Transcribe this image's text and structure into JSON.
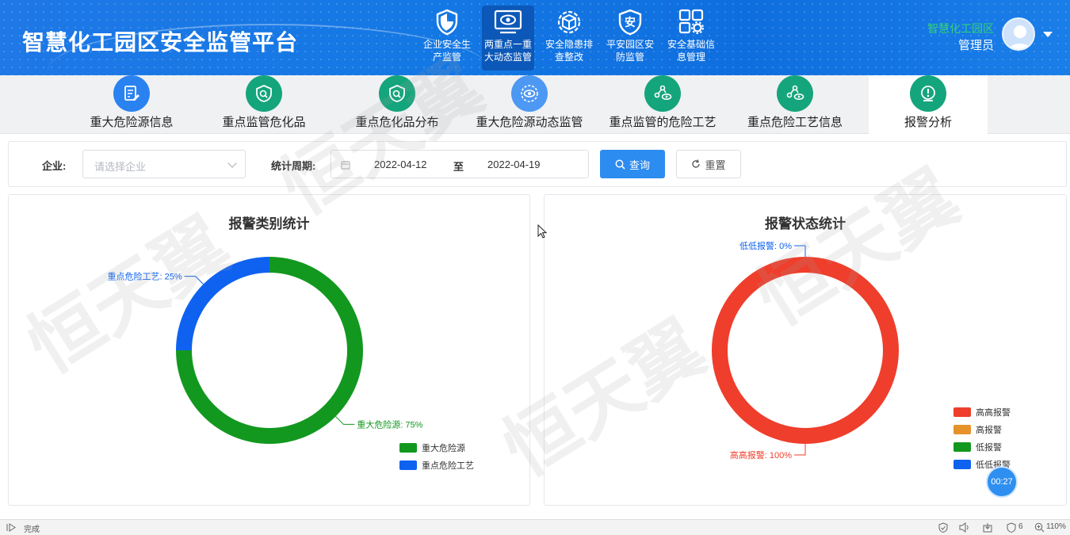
{
  "app": {
    "title": "智慧化工园区安全监管平台"
  },
  "top_nav": [
    {
      "label": "企业安全生产监管",
      "icon": "shield-icon",
      "active": false
    },
    {
      "label": "两重点一重大动态监管",
      "icon": "eye-monitor-icon",
      "active": true
    },
    {
      "label": "安全隐患排查整改",
      "icon": "cube-gear-icon",
      "active": false
    },
    {
      "label": "平安园区安防监管",
      "icon": "safe-shield-icon",
      "active": false
    },
    {
      "label": "安全基础信息管理",
      "icon": "grid-gear-icon",
      "active": false
    }
  ],
  "user": {
    "org": "智慧化工园区",
    "role": "管理员"
  },
  "sub_nav": [
    {
      "label": "重大危险源信息",
      "icon": "document-edit-icon",
      "active": false
    },
    {
      "label": "重点监管危化品",
      "icon": "chemical-shield-icon",
      "active": false
    },
    {
      "label": "重点危化品分布",
      "icon": "chemical-shield-icon",
      "active": false
    },
    {
      "label": "重大危险源动态监管",
      "icon": "radar-eye-icon",
      "active": false
    },
    {
      "label": "重点监管的危险工艺",
      "icon": "process-eye-icon",
      "active": false
    },
    {
      "label": "重点危险工艺信息",
      "icon": "process-eye-icon",
      "active": false
    },
    {
      "label": "报警分析",
      "icon": "alert-icon",
      "active": true
    }
  ],
  "filters": {
    "company_label": "企业:",
    "company_placeholder": "请选择企业",
    "period_label": "统计周期:",
    "date_start": "2022-04-12",
    "date_sep": "至",
    "date_end": "2022-04-19",
    "query_label": "查询",
    "reset_label": "重置"
  },
  "colors": {
    "green": "#13981f",
    "blue": "#0f62f0",
    "red": "#ef3e2c",
    "orange": "#e6922b",
    "accent": "#2d8cf0"
  },
  "chart_data": [
    {
      "type": "pie",
      "title": "报警类别统计",
      "slices": [
        {
          "name": "重大危险源",
          "value": 75,
          "label": "重大危险源: 75%",
          "color": "#13981f"
        },
        {
          "name": "重点危险工艺",
          "value": 25,
          "label": "重点危险工艺: 25%",
          "color": "#0f62f0"
        }
      ],
      "legend": [
        "重大危险源",
        "重点危险工艺"
      ],
      "legend_position": "bottom-right"
    },
    {
      "type": "pie",
      "title": "报警状态统计",
      "slices": [
        {
          "name": "高高报警",
          "value": 100,
          "label": "高高报警: 100%",
          "color": "#ef3e2c"
        },
        {
          "name": "高报警",
          "value": 0,
          "color": "#e6922b"
        },
        {
          "name": "低报警",
          "value": 0,
          "color": "#13981f"
        },
        {
          "name": "低低报警",
          "value": 0,
          "label": "低低报警: 0%",
          "color": "#0f62f0"
        }
      ],
      "legend": [
        "高高报警",
        "高报警",
        "低报警",
        "低低报警"
      ],
      "legend_position": "bottom-right"
    }
  ],
  "watermark": "恒天翼",
  "timer": "00:27",
  "statusbar": {
    "status": "完成",
    "shield_count": "6",
    "zoom": "110%"
  }
}
